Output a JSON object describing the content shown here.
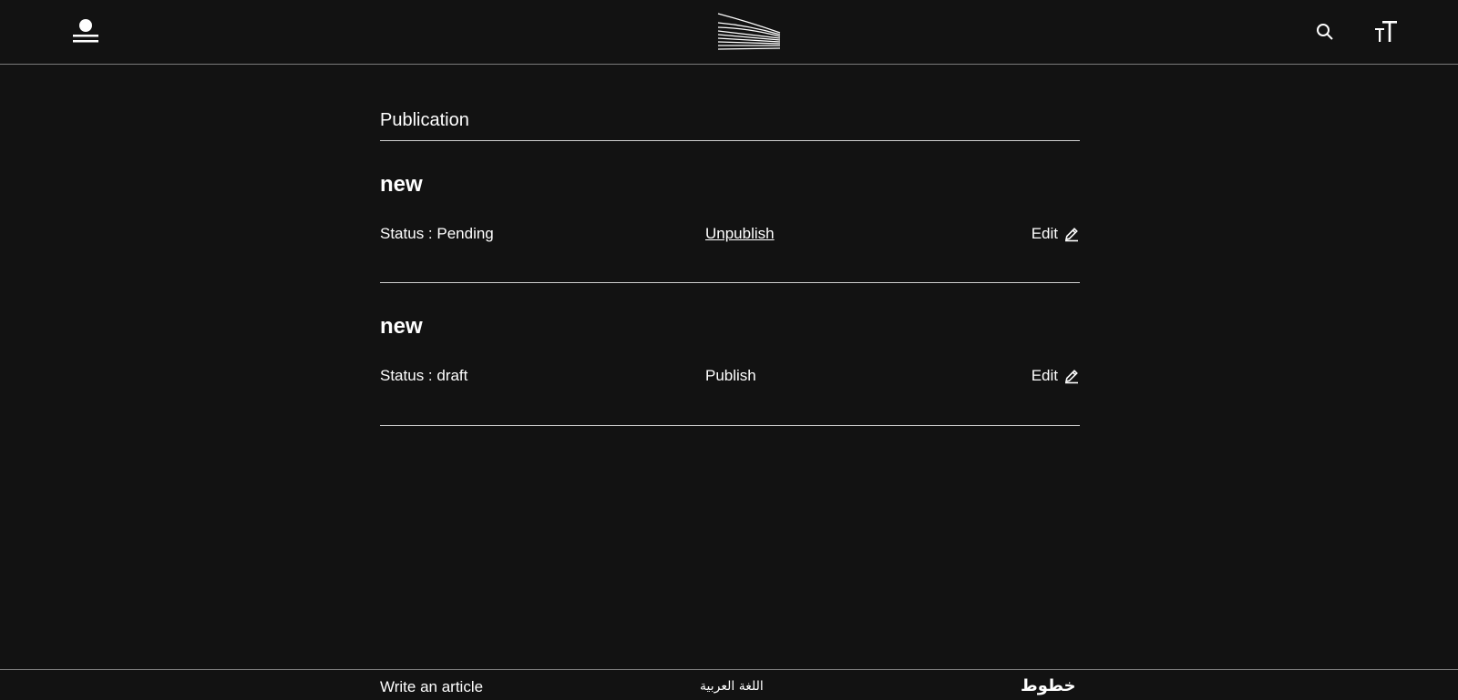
{
  "header": {
    "user_icon": "user-menu-icon",
    "logo_icon": "site-logo-lines",
    "search_icon": "search-icon",
    "text_size_icon": "text-size-icon"
  },
  "main": {
    "section_title": "Publication",
    "articles": [
      {
        "title": "new",
        "status": "Status : Pending",
        "action": "Unpublish",
        "edit": "Edit"
      },
      {
        "title": "new",
        "status": "Status : draft",
        "action": "Publish",
        "edit": "Edit"
      }
    ]
  },
  "footer": {
    "write_link": "Write an article",
    "language_link": "اللغة العربية",
    "logo_text": "خطوط"
  },
  "colors": {
    "background": "#121212",
    "text": "#ffffff",
    "divider": "#d0d0d0"
  }
}
